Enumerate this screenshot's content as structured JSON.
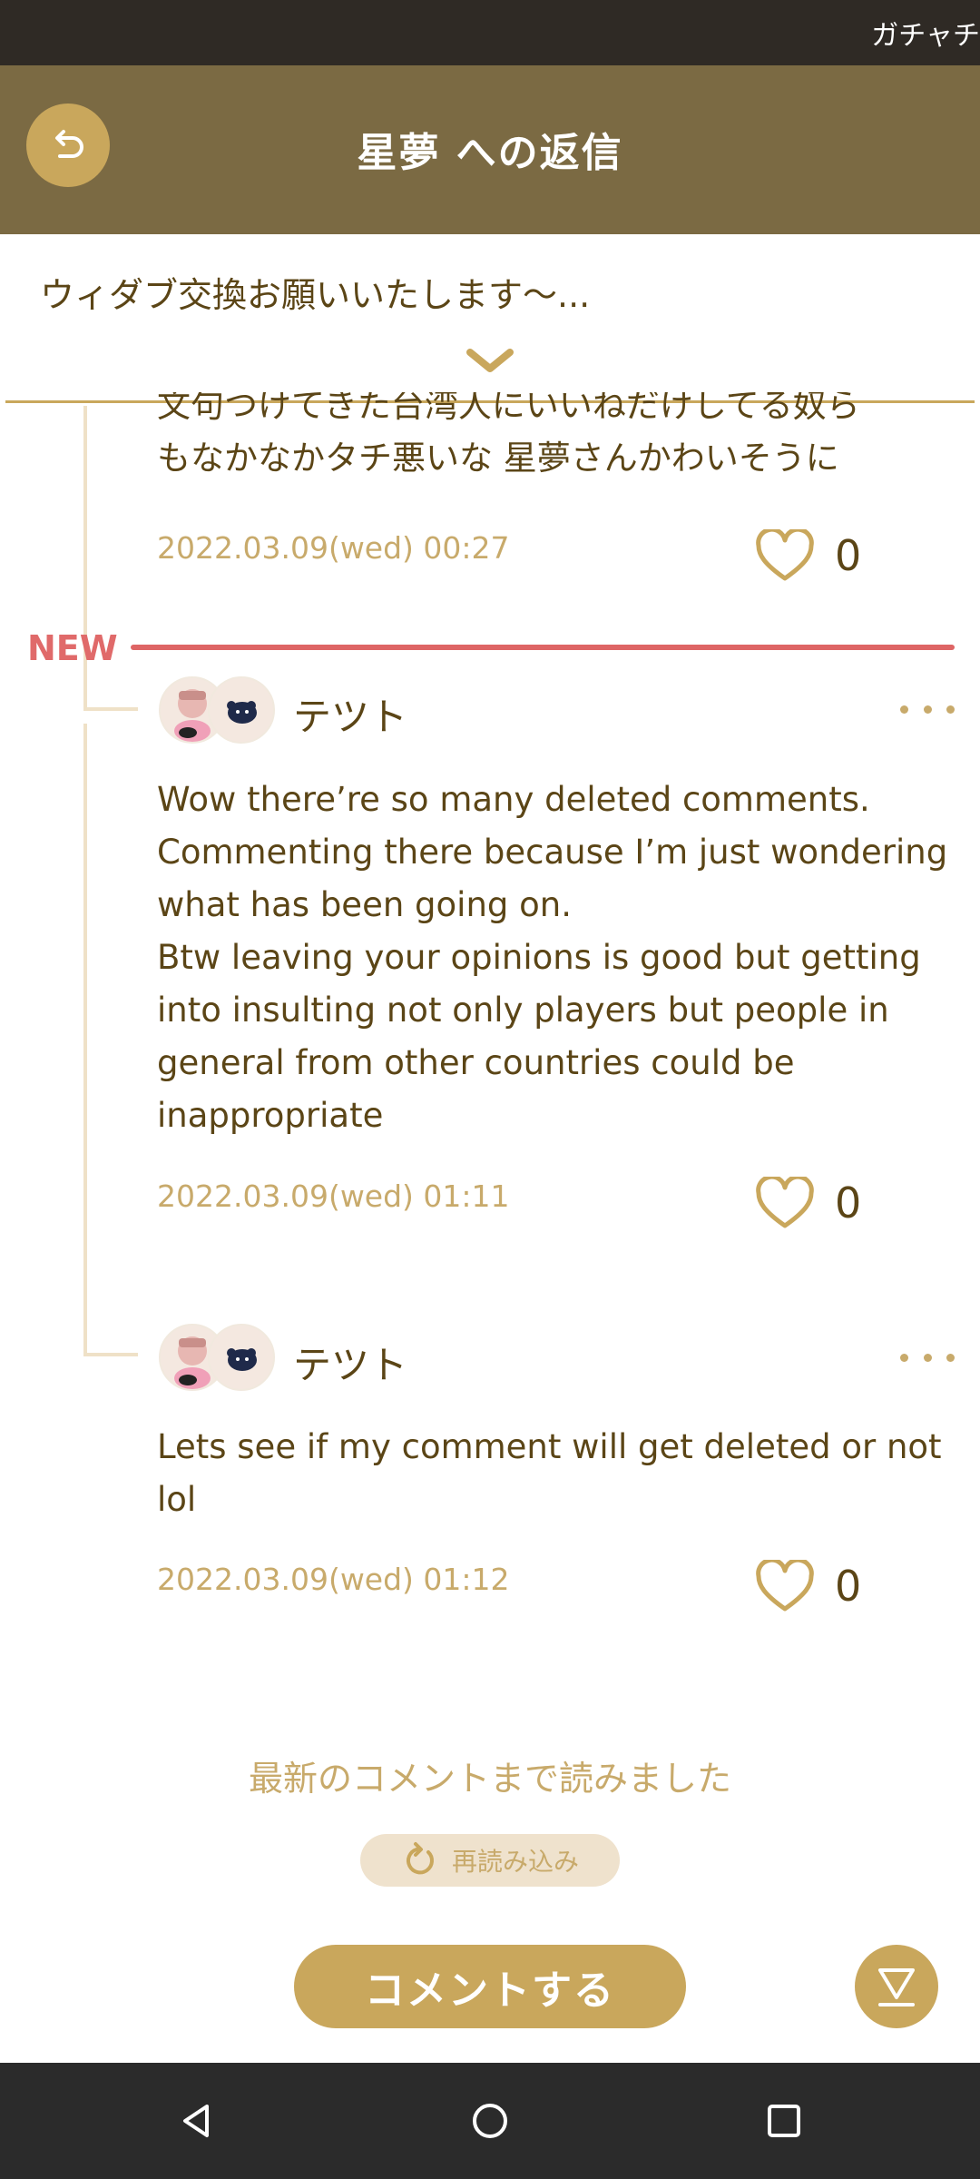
{
  "status_bar": {
    "ticker": "ガチャチ"
  },
  "header": {
    "title": "星夢 への返信"
  },
  "summary": {
    "text": "ウィダブ交換お願いいたします〜..."
  },
  "previous_comment": {
    "text_lines": [
      "文句つけてきた台湾人にいいねだけしてる奴ら",
      "もなかなかタチ悪いな 星夢さんかわいそうに"
    ],
    "date": "2022.03.09(wed) 00:27",
    "likes": "0"
  },
  "new_marker": "NEW",
  "comments": [
    {
      "username": "テツト",
      "text": "Wow there’re so many deleted comments.\nCommenting there because I’m just wondering what has been going on.\nBtw leaving your opinions is good but getting into insulting not only players but people in general from other countries could be inappropriate",
      "date": "2022.03.09(wed) 01:11",
      "likes": "0"
    },
    {
      "username": "テツト",
      "text": "Lets see if my comment will get deleted or not lol",
      "date": "2022.03.09(wed) 01:12",
      "likes": "0"
    }
  ],
  "footer": {
    "read_all": "最新のコメントまで読みました",
    "reload_label": "再読み込み",
    "comment_button": "コメントする"
  },
  "colors": {
    "header_bg": "#7b6a43",
    "accent": "#c9a75c",
    "text": "#5b4516",
    "date": "#c8aa6b",
    "new_marker": "#de6565"
  },
  "icons": [
    "back-arrow-icon",
    "chevron-down-icon",
    "heart-icon",
    "more-dots-icon",
    "reload-icon",
    "scroll-to-bottom-icon",
    "nav-back-icon",
    "nav-home-icon",
    "nav-recents-icon"
  ]
}
